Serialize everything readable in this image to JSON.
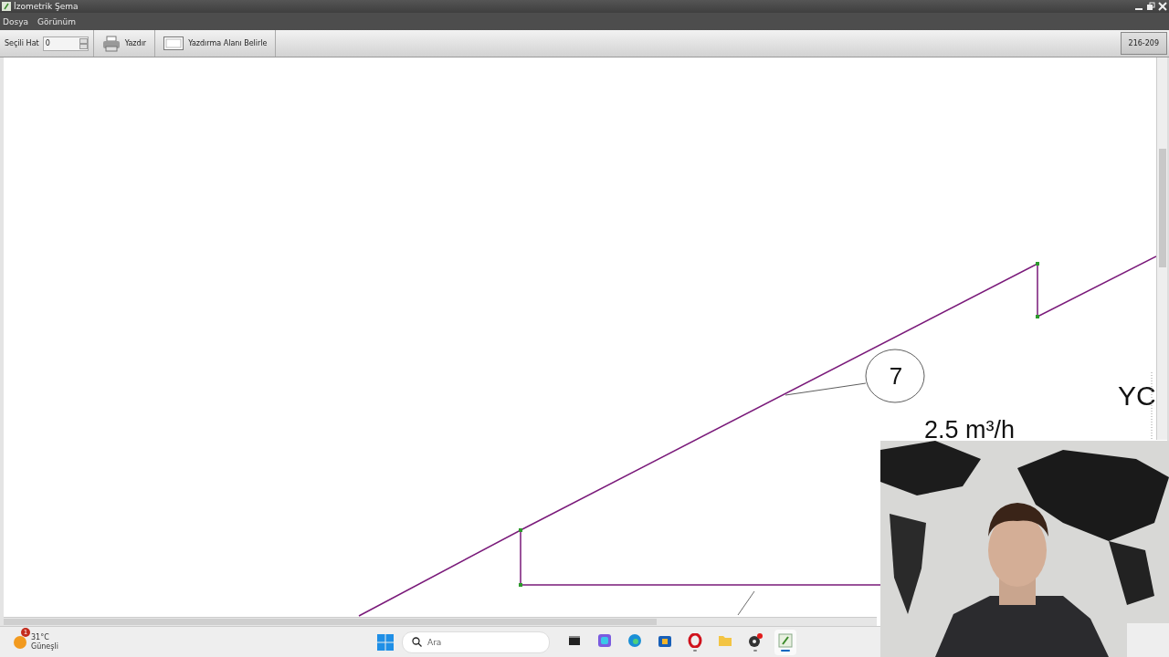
{
  "window": {
    "title": "İzometrik Şema"
  },
  "menu": [
    "Dosya",
    "Görünüm"
  ],
  "toolbar": {
    "selected_line_label": "Seçili Hat",
    "selected_line_value": "0",
    "print": "Yazdır",
    "print_area": "Yazdırma Alanı Belirle",
    "code": "216-209"
  },
  "canvas": {
    "balloon": "7",
    "flow": "2.5 m³/h",
    "label": "YC"
  },
  "taskbar": {
    "weather_badge": "1",
    "temperature": "31°C",
    "condition": "Güneşli",
    "search_placeholder": "Ara",
    "apps": [
      {
        "kind": "taskview",
        "running": false,
        "selected": false
      },
      {
        "kind": "copilot",
        "running": false,
        "selected": false
      },
      {
        "kind": "edge",
        "running": false,
        "selected": false
      },
      {
        "kind": "store",
        "running": false,
        "selected": false
      },
      {
        "kind": "opera",
        "running": true,
        "selected": false
      },
      {
        "kind": "files",
        "running": false,
        "selected": false
      },
      {
        "kind": "obs",
        "running": true,
        "selected": false
      },
      {
        "kind": "app",
        "running": true,
        "selected": true
      }
    ]
  }
}
